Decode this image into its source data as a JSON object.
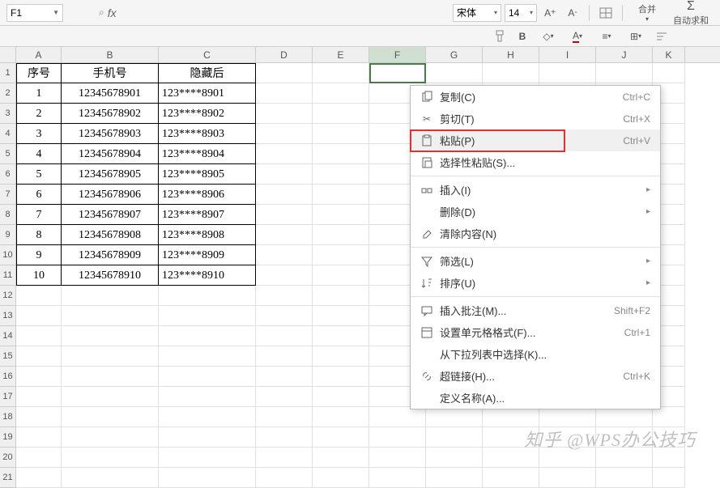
{
  "toolbar": {
    "namebox": "F1",
    "font_name": "宋体",
    "font_size": "14",
    "merge_label": "合并",
    "autosum_label": "自动求和"
  },
  "columns": [
    "A",
    "B",
    "C",
    "D",
    "E",
    "F",
    "G",
    "H",
    "I",
    "J",
    "K"
  ],
  "headers": {
    "a": "序号",
    "b": "手机号",
    "c": "隐藏后"
  },
  "rows": [
    {
      "n": "1",
      "phone": "12345678901",
      "masked": "123****8901"
    },
    {
      "n": "2",
      "phone": "12345678902",
      "masked": "123****8902"
    },
    {
      "n": "3",
      "phone": "12345678903",
      "masked": "123****8903"
    },
    {
      "n": "4",
      "phone": "12345678904",
      "masked": "123****8904"
    },
    {
      "n": "5",
      "phone": "12345678905",
      "masked": "123****8905"
    },
    {
      "n": "6",
      "phone": "12345678906",
      "masked": "123****8906"
    },
    {
      "n": "7",
      "phone": "12345678907",
      "masked": "123****8907"
    },
    {
      "n": "8",
      "phone": "12345678908",
      "masked": "123****8908"
    },
    {
      "n": "9",
      "phone": "12345678909",
      "masked": "123****8909"
    },
    {
      "n": "10",
      "phone": "12345678910",
      "masked": "123****8910"
    }
  ],
  "context_menu": {
    "copy": {
      "label": "复制(C)",
      "shortcut": "Ctrl+C"
    },
    "cut": {
      "label": "剪切(T)",
      "shortcut": "Ctrl+X"
    },
    "paste": {
      "label": "粘贴(P)",
      "shortcut": "Ctrl+V"
    },
    "paste_sp": {
      "label": "选择性粘贴(S)..."
    },
    "insert": {
      "label": "插入(I)"
    },
    "delete": {
      "label": "删除(D)"
    },
    "clear": {
      "label": "清除内容(N)"
    },
    "filter": {
      "label": "筛选(L)"
    },
    "sort": {
      "label": "排序(U)"
    },
    "comment": {
      "label": "插入批注(M)...",
      "shortcut": "Shift+F2"
    },
    "format": {
      "label": "设置单元格格式(F)...",
      "shortcut": "Ctrl+1"
    },
    "dropdown": {
      "label": "从下拉列表中选择(K)..."
    },
    "hyperlink": {
      "label": "超链接(H)...",
      "shortcut": "Ctrl+K"
    },
    "define_name": {
      "label": "定义名称(A)..."
    }
  },
  "watermark": "知乎 @WPS办公技巧"
}
